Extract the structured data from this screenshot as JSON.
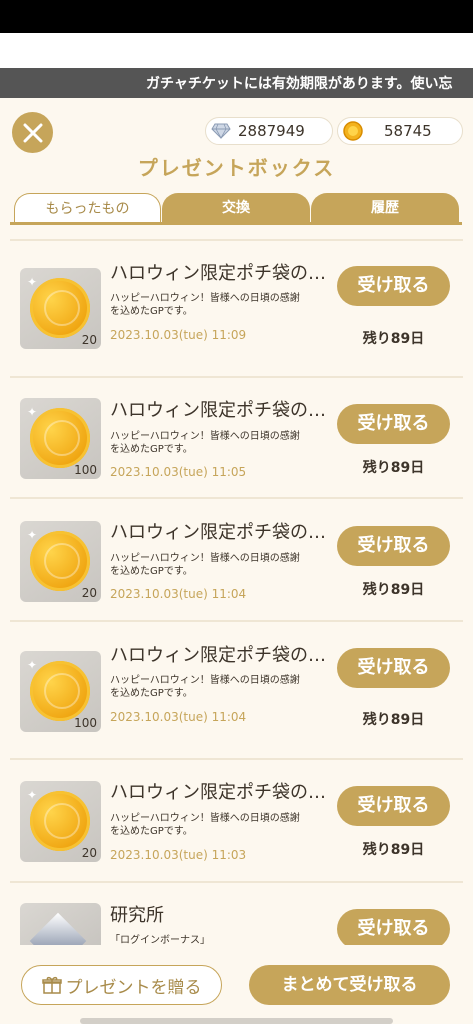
{
  "ticker": {
    "text": "ガチャチケットには有効期限があります。使い忘"
  },
  "header": {
    "close_icon": "close-icon",
    "diamond": {
      "icon": "diamond-icon",
      "value": "2887949"
    },
    "coin": {
      "icon": "coin-icon",
      "value": "58745"
    },
    "title": "プレゼントボックス"
  },
  "tabs": [
    {
      "label": "もらったもの",
      "active": true
    },
    {
      "label": "交換",
      "active": false
    },
    {
      "label": "履歴",
      "active": false
    }
  ],
  "items": [
    {
      "name": "ハロウィン限定ポチ袋の…",
      "desc_line1": "ハッピーハロウィン！皆様への日頃の感謝",
      "desc_line2": "を込めたGPです。",
      "date": "2023.10.03(tue) 11:09",
      "qty": "20",
      "button": "受け取る",
      "remain": "残り89日"
    },
    {
      "name": "ハロウィン限定ポチ袋の…",
      "desc_line1": "ハッピーハロウィン！皆様への日頃の感謝",
      "desc_line2": "を込めたGPです。",
      "date": "2023.10.03(tue) 11:05",
      "qty": "100",
      "button": "受け取る",
      "remain": "残り89日"
    },
    {
      "name": "ハロウィン限定ポチ袋の…",
      "desc_line1": "ハッピーハロウィン！皆様への日頃の感謝",
      "desc_line2": "を込めたGPです。",
      "date": "2023.10.03(tue) 11:04",
      "qty": "20",
      "button": "受け取る",
      "remain": "残り89日"
    },
    {
      "name": "ハロウィン限定ポチ袋の…",
      "desc_line1": "ハッピーハロウィン！皆様への日頃の感謝",
      "desc_line2": "を込めたGPです。",
      "date": "2023.10.03(tue) 11:04",
      "qty": "100",
      "button": "受け取る",
      "remain": "残り89日"
    },
    {
      "name": "ハロウィン限定ポチ袋の…",
      "desc_line1": "ハッピーハロウィン！皆様への日頃の感謝",
      "desc_line2": "を込めたGPです。",
      "date": "2023.10.03(tue) 11:03",
      "qty": "20",
      "button": "受け取る",
      "remain": "残り89日"
    }
  ],
  "partial_item": {
    "name": "研究所",
    "desc": "「ログインボーナス」",
    "button": "受け取る"
  },
  "footer": {
    "gift_label": "プレゼントを贈る",
    "receive_all_label": "まとめて受け取る"
  },
  "colors": {
    "accent": "#c6a55a",
    "background": "#fdf8ef",
    "text": "#3d342a"
  }
}
